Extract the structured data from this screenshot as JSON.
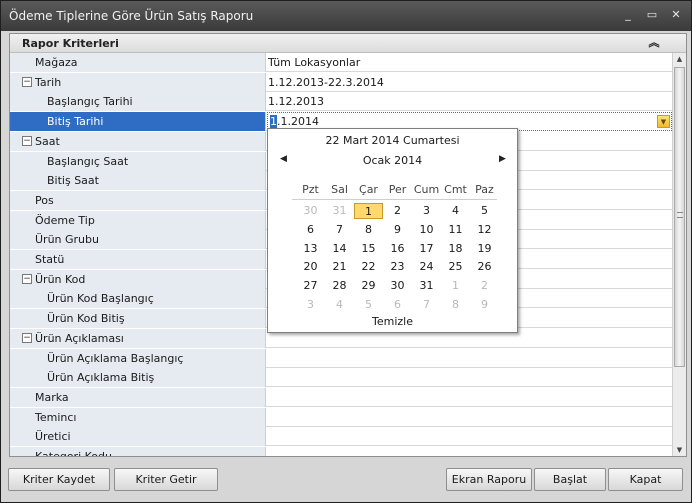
{
  "window": {
    "title": "Ödeme Tiplerine Göre Ürün Satış Raporu",
    "minimize": "_",
    "maximize": "▭",
    "close": "✕"
  },
  "category": {
    "label": "Rapor Kriterleri",
    "collapse_glyph": "︽"
  },
  "rows": [
    {
      "name": "Mağaza",
      "value": "Tüm Lokasyonlar",
      "indent": 1,
      "expander": ""
    },
    {
      "name": "Tarih",
      "value": "1.12.2013-22.3.2014",
      "indent": 0,
      "expander": "⊟"
    },
    {
      "name": "Başlangıç Tarihi",
      "value": "1.12.2013",
      "indent": 2,
      "expander": ""
    },
    {
      "name": "Bitiş Tarihi",
      "value": "",
      "indent": 2,
      "expander": "",
      "selected": true
    },
    {
      "name": "Saat",
      "value": "",
      "indent": 0,
      "expander": "⊟"
    },
    {
      "name": "Başlangıç Saat",
      "value": "",
      "indent": 2,
      "expander": ""
    },
    {
      "name": "Bitiş Saat",
      "value": "",
      "indent": 2,
      "expander": ""
    },
    {
      "name": "Pos",
      "value": "",
      "indent": 1,
      "expander": ""
    },
    {
      "name": "Ödeme Tip",
      "value": "",
      "indent": 1,
      "expander": ""
    },
    {
      "name": "Ürün Grubu",
      "value": "",
      "indent": 1,
      "expander": ""
    },
    {
      "name": "Statü",
      "value": "",
      "indent": 1,
      "expander": ""
    },
    {
      "name": "Ürün Kod",
      "value": "",
      "indent": 0,
      "expander": "⊟"
    },
    {
      "name": "Ürün Kod Başlangıç",
      "value": "",
      "indent": 2,
      "expander": ""
    },
    {
      "name": "Ürün Kod Bitiş",
      "value": "",
      "indent": 2,
      "expander": ""
    },
    {
      "name": "Ürün Açıklaması",
      "value": "",
      "indent": 0,
      "expander": "⊟"
    },
    {
      "name": "Ürün Açıklama Başlangıç",
      "value": "",
      "indent": 2,
      "expander": ""
    },
    {
      "name": "Ürün Açıklama Bitiş",
      "value": "",
      "indent": 2,
      "expander": ""
    },
    {
      "name": "Marka",
      "value": "",
      "indent": 1,
      "expander": ""
    },
    {
      "name": "Temincı",
      "value": "",
      "indent": 1,
      "expander": ""
    },
    {
      "name": "Üretici",
      "value": "",
      "indent": 1,
      "expander": ""
    },
    {
      "name": "Kategori Kodu",
      "value": "",
      "indent": 1,
      "expander": ""
    }
  ],
  "editor": {
    "caret_char": "1",
    "rest": ".1.2014",
    "dropdown_glyph": "▼"
  },
  "calendar": {
    "today_label": "22 Mart 2014 Cumartesi",
    "month_label": "Ocak 2014",
    "prev_glyph": "◀",
    "next_glyph": "▶",
    "weekdays": [
      "Pzt",
      "Sal",
      "Çar",
      "Per",
      "Cum",
      "Cmt",
      "Paz"
    ],
    "weeks": [
      [
        {
          "d": "30",
          "o": true
        },
        {
          "d": "31",
          "o": true
        },
        {
          "d": "1",
          "s": true
        },
        {
          "d": "2"
        },
        {
          "d": "3"
        },
        {
          "d": "4"
        },
        {
          "d": "5"
        }
      ],
      [
        {
          "d": "6"
        },
        {
          "d": "7"
        },
        {
          "d": "8"
        },
        {
          "d": "9"
        },
        {
          "d": "10"
        },
        {
          "d": "11"
        },
        {
          "d": "12"
        }
      ],
      [
        {
          "d": "13"
        },
        {
          "d": "14"
        },
        {
          "d": "15"
        },
        {
          "d": "16"
        },
        {
          "d": "17"
        },
        {
          "d": "18"
        },
        {
          "d": "19"
        }
      ],
      [
        {
          "d": "20"
        },
        {
          "d": "21"
        },
        {
          "d": "22"
        },
        {
          "d": "23"
        },
        {
          "d": "24"
        },
        {
          "d": "25"
        },
        {
          "d": "26"
        }
      ],
      [
        {
          "d": "27"
        },
        {
          "d": "28"
        },
        {
          "d": "29"
        },
        {
          "d": "30"
        },
        {
          "d": "31"
        },
        {
          "d": "1",
          "o": true
        },
        {
          "d": "2",
          "o": true
        }
      ],
      [
        {
          "d": "3",
          "o": true
        },
        {
          "d": "4",
          "o": true
        },
        {
          "d": "5",
          "o": true
        },
        {
          "d": "6",
          "o": true
        },
        {
          "d": "7",
          "o": true
        },
        {
          "d": "8",
          "o": true
        },
        {
          "d": "9",
          "o": true
        }
      ]
    ],
    "clear_label": "Temizle"
  },
  "footer": {
    "save_criteria": "Kriter Kaydet",
    "load_criteria": "Kriter Getir",
    "screen_report": "Ekran Raporu",
    "start": "Başlat",
    "close": "Kapat"
  }
}
